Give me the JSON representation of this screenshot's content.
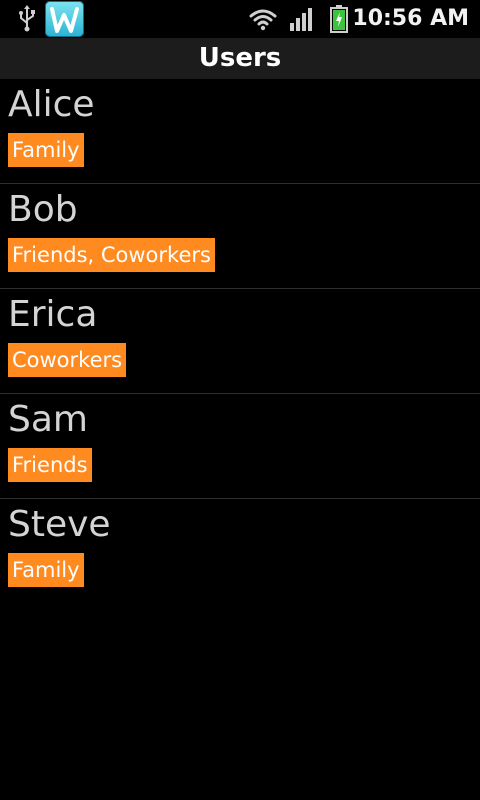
{
  "status_bar": {
    "time": "10:56 AM",
    "icons": [
      "usb-icon",
      "app-icon",
      "wifi-icon",
      "signal-icon",
      "battery-charging-icon"
    ]
  },
  "header": {
    "title": "Users"
  },
  "users": [
    {
      "name": "Alice",
      "groups": "Family"
    },
    {
      "name": "Bob",
      "groups": "Friends, Coworkers"
    },
    {
      "name": "Erica",
      "groups": "Coworkers"
    },
    {
      "name": "Sam",
      "groups": "Friends"
    },
    {
      "name": "Steve",
      "groups": "Family"
    }
  ],
  "colors": {
    "badge": "#ff8a1f",
    "background": "#000000",
    "title_bar": "#1c1c1c"
  }
}
